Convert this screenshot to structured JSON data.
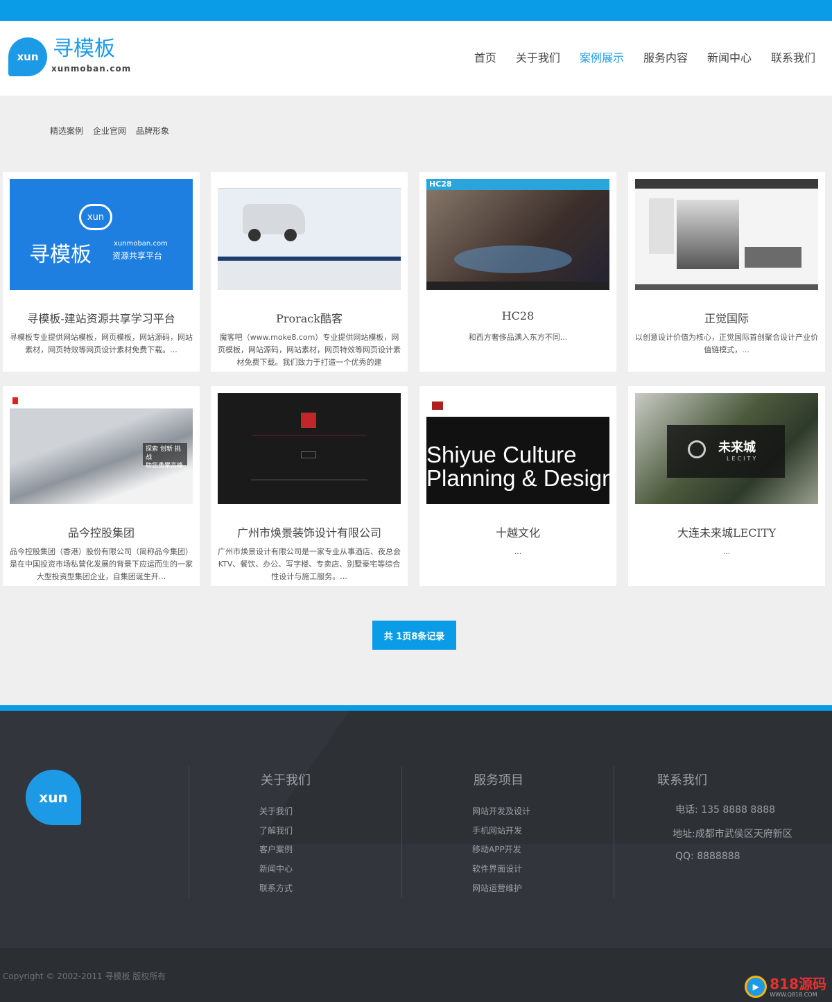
{
  "header": {
    "logo_badge": "xun",
    "logo_name": "寻模板",
    "logo_domain": "xunmoban.com",
    "nav": [
      {
        "label": "首页"
      },
      {
        "label": "关于我们"
      },
      {
        "label": "案例展示"
      },
      {
        "label": "服务内容"
      },
      {
        "label": "新闻中心"
      },
      {
        "label": "联系我们"
      }
    ]
  },
  "filters": [
    "精选案例",
    "企业官网",
    "品牌形象"
  ],
  "cases": [
    {
      "title": "寻模板-建站资源共享学习平台",
      "desc": "寻模板专业提供网站模板，网页模板，网站源码，网站素材，网页特效等网页设计素材免费下载。...",
      "thumb_line1": "xunmoban.com",
      "thumb_line2": "资源共享平台"
    },
    {
      "title": "Prorack酷客",
      "desc": "魔客吧（www.moke8.com）专业提供网站模板，网页模板，网站源码，网站素材，网页特效等网页设计素材免费下载。我们致力于打造一个优秀的建"
    },
    {
      "title": "HC28",
      "desc": "和西方奢侈品满入东方不同..."
    },
    {
      "title": "正觉国际",
      "desc": "以创意设计价值为核心，正觉国际首创聚合设计产业价值链模式，..."
    },
    {
      "title": "品今控股集团",
      "desc": "品今控股集团（香港）股份有限公司（简称品今集团）是在中国投资市场私营化发展的背景下应运而生的一家大型投资型集团企业，自集团诞生开...",
      "thumb_tag1": "探索 创新 挑战",
      "thumb_tag2": "助您勇攀高峰"
    },
    {
      "title": "广州市焕景装饰设计有限公司",
      "desc": "广州市焕景设计有限公司是一家专业从事酒店、夜总会KTV、餐饮、办公、写字楼、专卖店、别墅豪宅等综合性设计与施工服务。..."
    },
    {
      "title": "十越文化",
      "desc": "...",
      "thumb_text1": "Shiyue Culture",
      "thumb_text2": "Planning & Design"
    },
    {
      "title": "大连未来城LECITY",
      "desc": "...",
      "thumb_logo": "未来城",
      "thumb_logo_sub": "LECITY"
    }
  ],
  "pager": {
    "label": "共 1页8条记录"
  },
  "footer": {
    "badge": "xun",
    "col1": {
      "title": "关于我们",
      "links": [
        "关于我们",
        "了解我们",
        "客户案例",
        "新闻中心",
        "联系方式"
      ]
    },
    "col2": {
      "title": "服务项目",
      "links": [
        "网站开发及设计",
        "手机网站开发",
        "移动APP开发",
        "软件界面设计",
        "网站运营维护"
      ]
    },
    "col3": {
      "title": "联系我们",
      "lines": [
        "电话: 135 8888 8888",
        "地址:成都市武侯区天府新区",
        "QQ: 8888888"
      ]
    }
  },
  "copyright": "Copyright © 2002-2011 寻模板 版权所有",
  "watermark": {
    "main": "818源码",
    "sub": "WWW.Q818.COM"
  },
  "colors": {
    "accent": "#0a9ce6",
    "footer_bg": "#32363c"
  }
}
